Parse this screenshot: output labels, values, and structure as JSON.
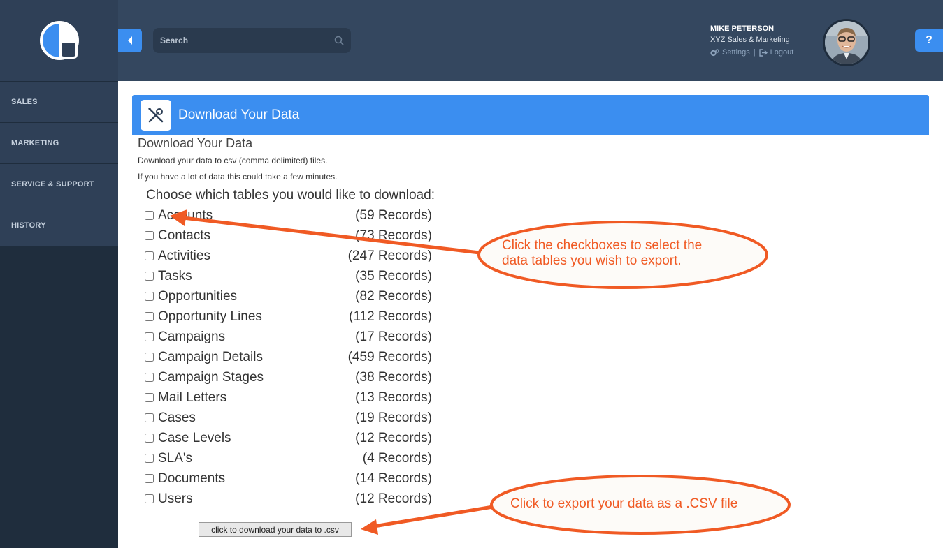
{
  "sidebar": {
    "items": [
      {
        "label": "SALES"
      },
      {
        "label": "MARKETING"
      },
      {
        "label": "SERVICE & SUPPORT"
      },
      {
        "label": "HISTORY"
      }
    ]
  },
  "header": {
    "search_placeholder": "Search",
    "user_name": "MIKE PETERSON",
    "user_company": "XYZ Sales & Marketing",
    "settings_label": "Settings",
    "separator": "|",
    "logout_label": "Logout",
    "help_label": "?"
  },
  "panel": {
    "title": "Download Your Data"
  },
  "content": {
    "title": "Download Your Data",
    "desc1": "Download your data to csv (comma delimited) files.",
    "desc2": "If you have a lot of data this could take a few minutes.",
    "choose_label": "Choose which tables you would like to download:",
    "tables": [
      {
        "name": "Accounts",
        "count": "(59 Records)"
      },
      {
        "name": "Contacts",
        "count": "(73 Records)"
      },
      {
        "name": "Activities",
        "count": "(247 Records)"
      },
      {
        "name": "Tasks",
        "count": "(35 Records)"
      },
      {
        "name": "Opportunities",
        "count": "(82 Records)"
      },
      {
        "name": "Opportunity Lines",
        "count": "(112 Records)"
      },
      {
        "name": "Campaigns",
        "count": "(17 Records)"
      },
      {
        "name": "Campaign Details",
        "count": "(459 Records)"
      },
      {
        "name": "Campaign Stages",
        "count": "(38 Records)"
      },
      {
        "name": "Mail Letters",
        "count": "(13 Records)"
      },
      {
        "name": "Cases",
        "count": "(19 Records)"
      },
      {
        "name": "Case Levels",
        "count": "(12 Records)"
      },
      {
        "name": "SLA's",
        "count": "(4 Records)"
      },
      {
        "name": "Documents",
        "count": "(14 Records)"
      },
      {
        "name": "Users",
        "count": "(12 Records)"
      }
    ],
    "download_button": "click to download your data to .csv"
  },
  "annotations": {
    "callout1_line1": "Click the checkboxes to select the",
    "callout1_line2": "data tables you wish to export.",
    "callout2": "Click to export your data as a .CSV file",
    "color": "#f05a24"
  },
  "colors": {
    "accent": "#3b8ef0",
    "sidebar_bg": "#1f2d3d",
    "header_bg": "#34475f"
  }
}
